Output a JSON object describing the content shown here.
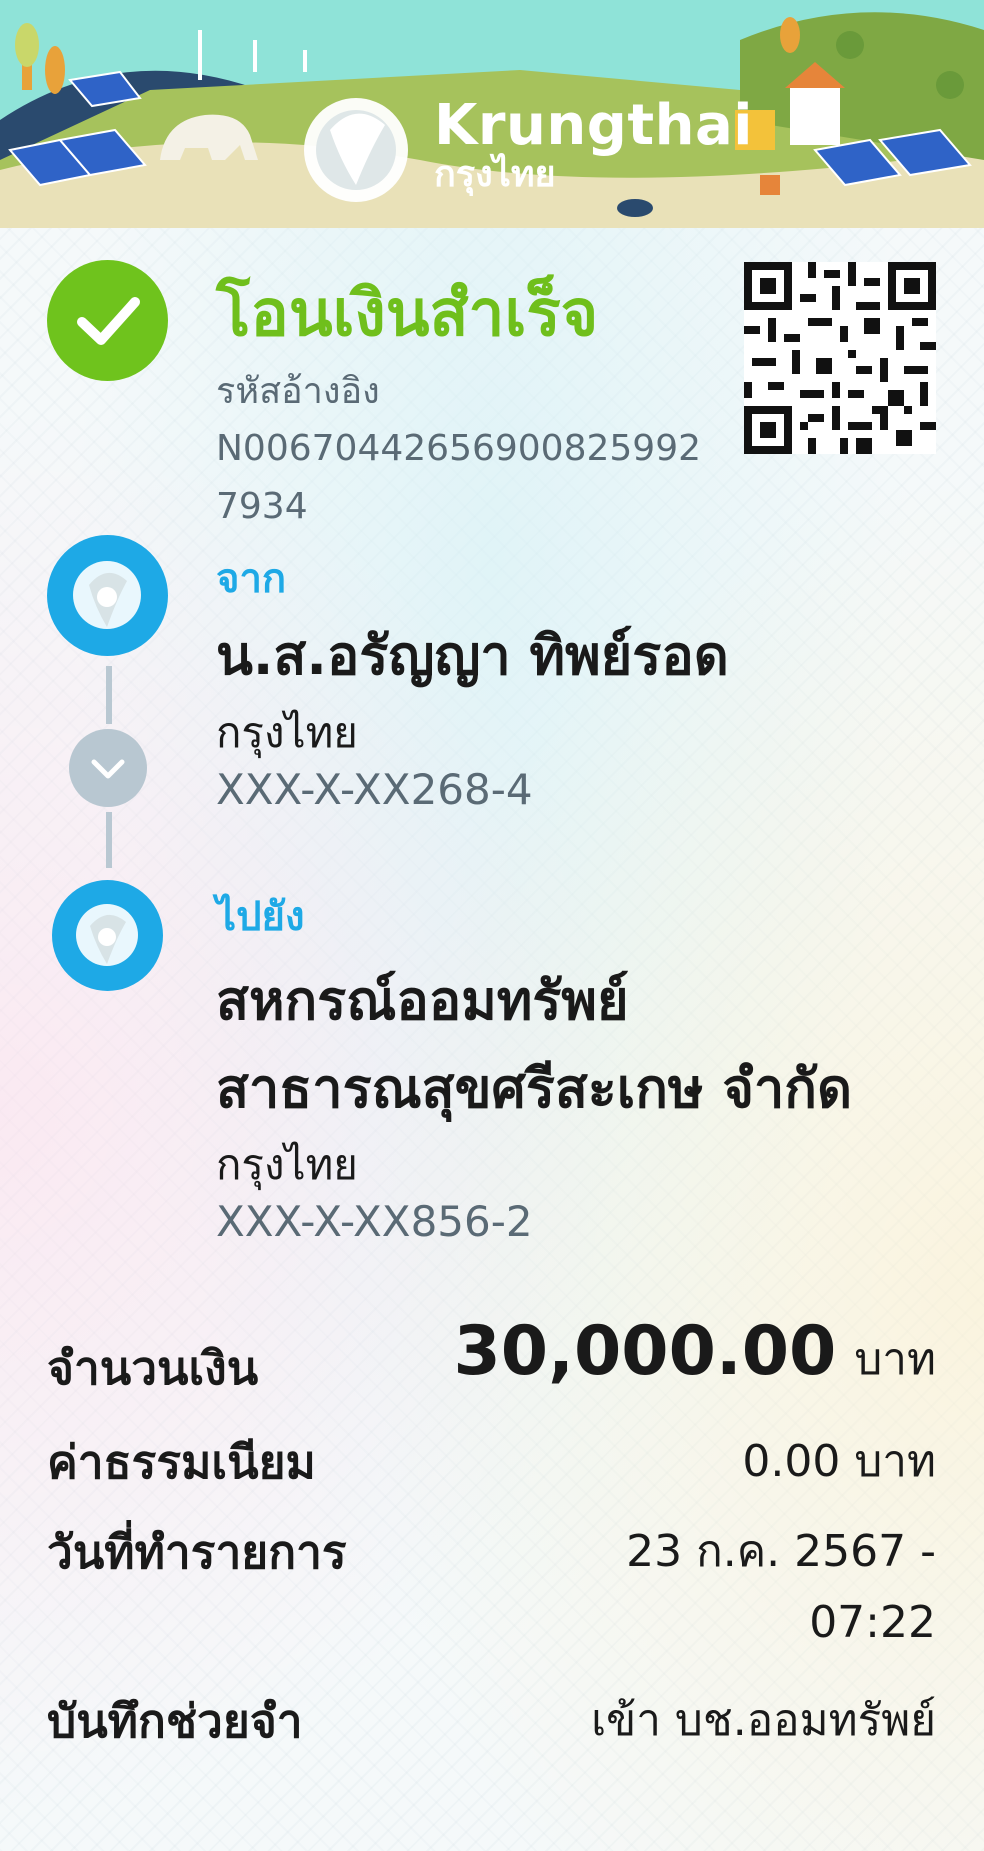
{
  "banner": {
    "brand_en": "Krungthai",
    "brand_th": "กรุงไทย",
    "colors": {
      "sky": "#8fe3d8",
      "grass": "#a3c058",
      "dark_roof": "#23395f"
    }
  },
  "status": {
    "title": "โอนเงินสำเร็จ",
    "ref_label": "รหัสอ้างอิง",
    "ref_value": "N006704426569008259927934",
    "icon": "check-icon",
    "color": "#6fc31d"
  },
  "from": {
    "label": "จาก",
    "name": "น.ส.อรัญญา ทิพย์รอด",
    "bank": "กรุงไทย",
    "account": "XXX-X-XX268-4"
  },
  "to": {
    "label": "ไปยัง",
    "name_line1": "สหกรณ์ออมทรัพย์",
    "name_line2": "สาธารณสุขศรีสะเกษ จำกัด",
    "bank": "กรุงไทย",
    "account": "XXX-X-XX856-2"
  },
  "summary": {
    "amount_label": "จำนวนเงิน",
    "amount_value": "30,000.00",
    "amount_unit": "บาท",
    "fee_label": "ค่าธรรมเนียม",
    "fee_value": "0.00 บาท",
    "date_label": "วันที่ทำรายการ",
    "date_line1": "23 ก.ค. 2567 -",
    "date_line2": "07:22",
    "memo_label": "บันทึกช่วยจำ",
    "memo_value": "เข้า บช.ออมทรัพย์"
  },
  "accent_blue": "#1ea9e6"
}
